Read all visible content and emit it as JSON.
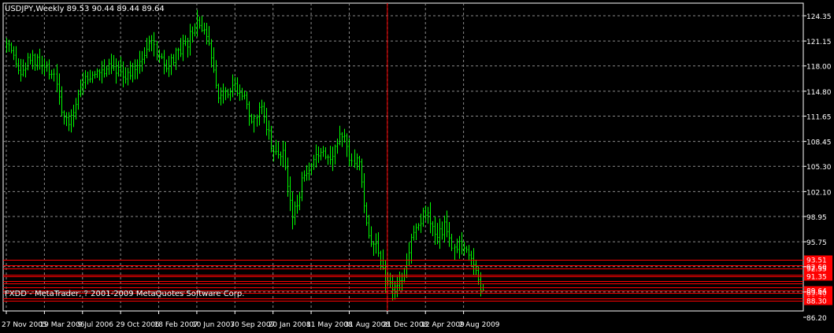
{
  "window": {
    "symbol_header": "USDJPY,Weekly  89.53 90.44 89.44 89.64",
    "footer_text": "FXDD - MetaTrader, ? 2001-2009 MetaQuotes Software Corp."
  },
  "colors": {
    "background": "#000000",
    "grid": "#8a8a8a",
    "candle": "#00ff00",
    "levels": "#ff0000",
    "axis_text": "#ffffff",
    "frame": "#ffffff"
  },
  "chart_data": {
    "type": "candlestick",
    "title": "USDJPY,Weekly",
    "last_bar": {
      "open": 89.53,
      "high": 90.44,
      "low": 89.44,
      "close": 89.64
    },
    "ylim": [
      85.5,
      125.5
    ],
    "grid": true,
    "y_ticks": [
      "124.35",
      "121.15",
      "118.00",
      "114.80",
      "111.65",
      "108.45",
      "105.30",
      "102.10",
      "98.95",
      "95.75",
      "92.60",
      "89.40",
      "86.20"
    ],
    "x_ticks": [
      "27 Nov 2005",
      "19 Mar 2006",
      "9 Jul 2006",
      "29 Oct 2006",
      "18 Feb 2007",
      "10 Jun 2007",
      "30 Sep 2007",
      "20 Jan 2008",
      "11 May 2008",
      "31 Aug 2008",
      "21 Dec 2008",
      "12 Apr 2009",
      "2 Aug 2009"
    ],
    "price_path": [
      [
        "27 Nov 2005",
        120.5
      ],
      [
        "8 Jan 2006",
        116.8
      ],
      [
        "5 Feb 2006",
        119.0
      ],
      [
        "19 Mar 2006",
        117.6
      ],
      [
        "16 Apr 2006",
        117.2
      ],
      [
        "14 May 2006",
        111.0
      ],
      [
        "28 May 2006",
        110.4
      ],
      [
        "25 Jun 2006",
        114.6
      ],
      [
        "9 Jul 2006",
        116.2
      ],
      [
        "6 Aug 2006",
        116.6
      ],
      [
        "3 Sep 2006",
        117.5
      ],
      [
        "1 Oct 2006",
        118.5
      ],
      [
        "29 Oct 2006",
        117.1
      ],
      [
        "26 Nov 2006",
        116.8
      ],
      [
        "24 Dec 2006",
        118.8
      ],
      [
        "21 Jan 2007",
        121.0
      ],
      [
        "18 Feb 2007",
        119.4
      ],
      [
        "11 Mar 2007",
        117.2
      ],
      [
        "8 Apr 2007",
        119.3
      ],
      [
        "6 May 2007",
        120.3
      ],
      [
        "10 Jun 2007",
        123.5
      ],
      [
        "24 Jun 2007",
        123.0
      ],
      [
        "22 Jul 2007",
        119.2
      ],
      [
        "12 Aug 2007",
        114.7
      ],
      [
        "30 Sep 2007",
        115.5
      ],
      [
        "28 Oct 2007",
        114.6
      ],
      [
        "18 Nov 2007",
        110.2
      ],
      [
        "16 Dec 2007",
        113.3
      ],
      [
        "20 Jan 2008",
        106.8
      ],
      [
        "17 Feb 2008",
        107.3
      ],
      [
        "16 Mar 2008",
        98.5
      ],
      [
        "13 Apr 2008",
        103.1
      ],
      [
        "11 May 2008",
        104.8
      ],
      [
        "8 Jun 2008",
        107.6
      ],
      [
        "6 Jul 2008",
        106.6
      ],
      [
        "10 Aug 2008",
        109.4
      ],
      [
        "31 Aug 2008",
        106.8
      ],
      [
        "28 Sep 2008",
        105.6
      ],
      [
        "19 Oct 2008",
        97.5
      ],
      [
        "16 Nov 2008",
        94.8
      ],
      [
        "21 Dec 2008",
        90.6
      ],
      [
        "11 Jan 2009",
        90.0
      ],
      [
        "8 Feb 2009",
        91.6
      ],
      [
        "8 Mar 2009",
        97.6
      ],
      [
        "12 Apr 2009",
        99.6
      ],
      [
        "10 May 2009",
        96.1
      ],
      [
        "7 Jun 2009",
        97.8
      ],
      [
        "28 Jun 2009",
        95.6
      ],
      [
        "2 Aug 2009",
        95.4
      ],
      [
        "30 Aug 2009",
        92.7
      ],
      [
        "27 Sep 2009",
        89.6
      ]
    ],
    "horizontal_levels": [
      {
        "price": 93.51,
        "label": "93.51",
        "labeled": true
      },
      {
        "price": 92.8,
        "label": "",
        "labeled": false
      },
      {
        "price": 92.35,
        "label": "92.35",
        "labeled": true
      },
      {
        "price": 91.6,
        "label": "",
        "labeled": false
      },
      {
        "price": 91.35,
        "label": "91.35",
        "labeled": true
      },
      {
        "price": 90.8,
        "label": "",
        "labeled": false
      },
      {
        "price": 90.5,
        "label": "",
        "labeled": false
      },
      {
        "price": 90.0,
        "label": "",
        "labeled": false
      },
      {
        "price": 89.6,
        "label": "89.64",
        "labeled": true
      },
      {
        "price": 89.3,
        "label": "",
        "labeled": false
      },
      {
        "price": 88.6,
        "label": "88.60",
        "labeled": true
      },
      {
        "price": 88.3,
        "label": "88.30",
        "labeled": true
      }
    ],
    "vertical_marker": "21 Dec 2008"
  }
}
